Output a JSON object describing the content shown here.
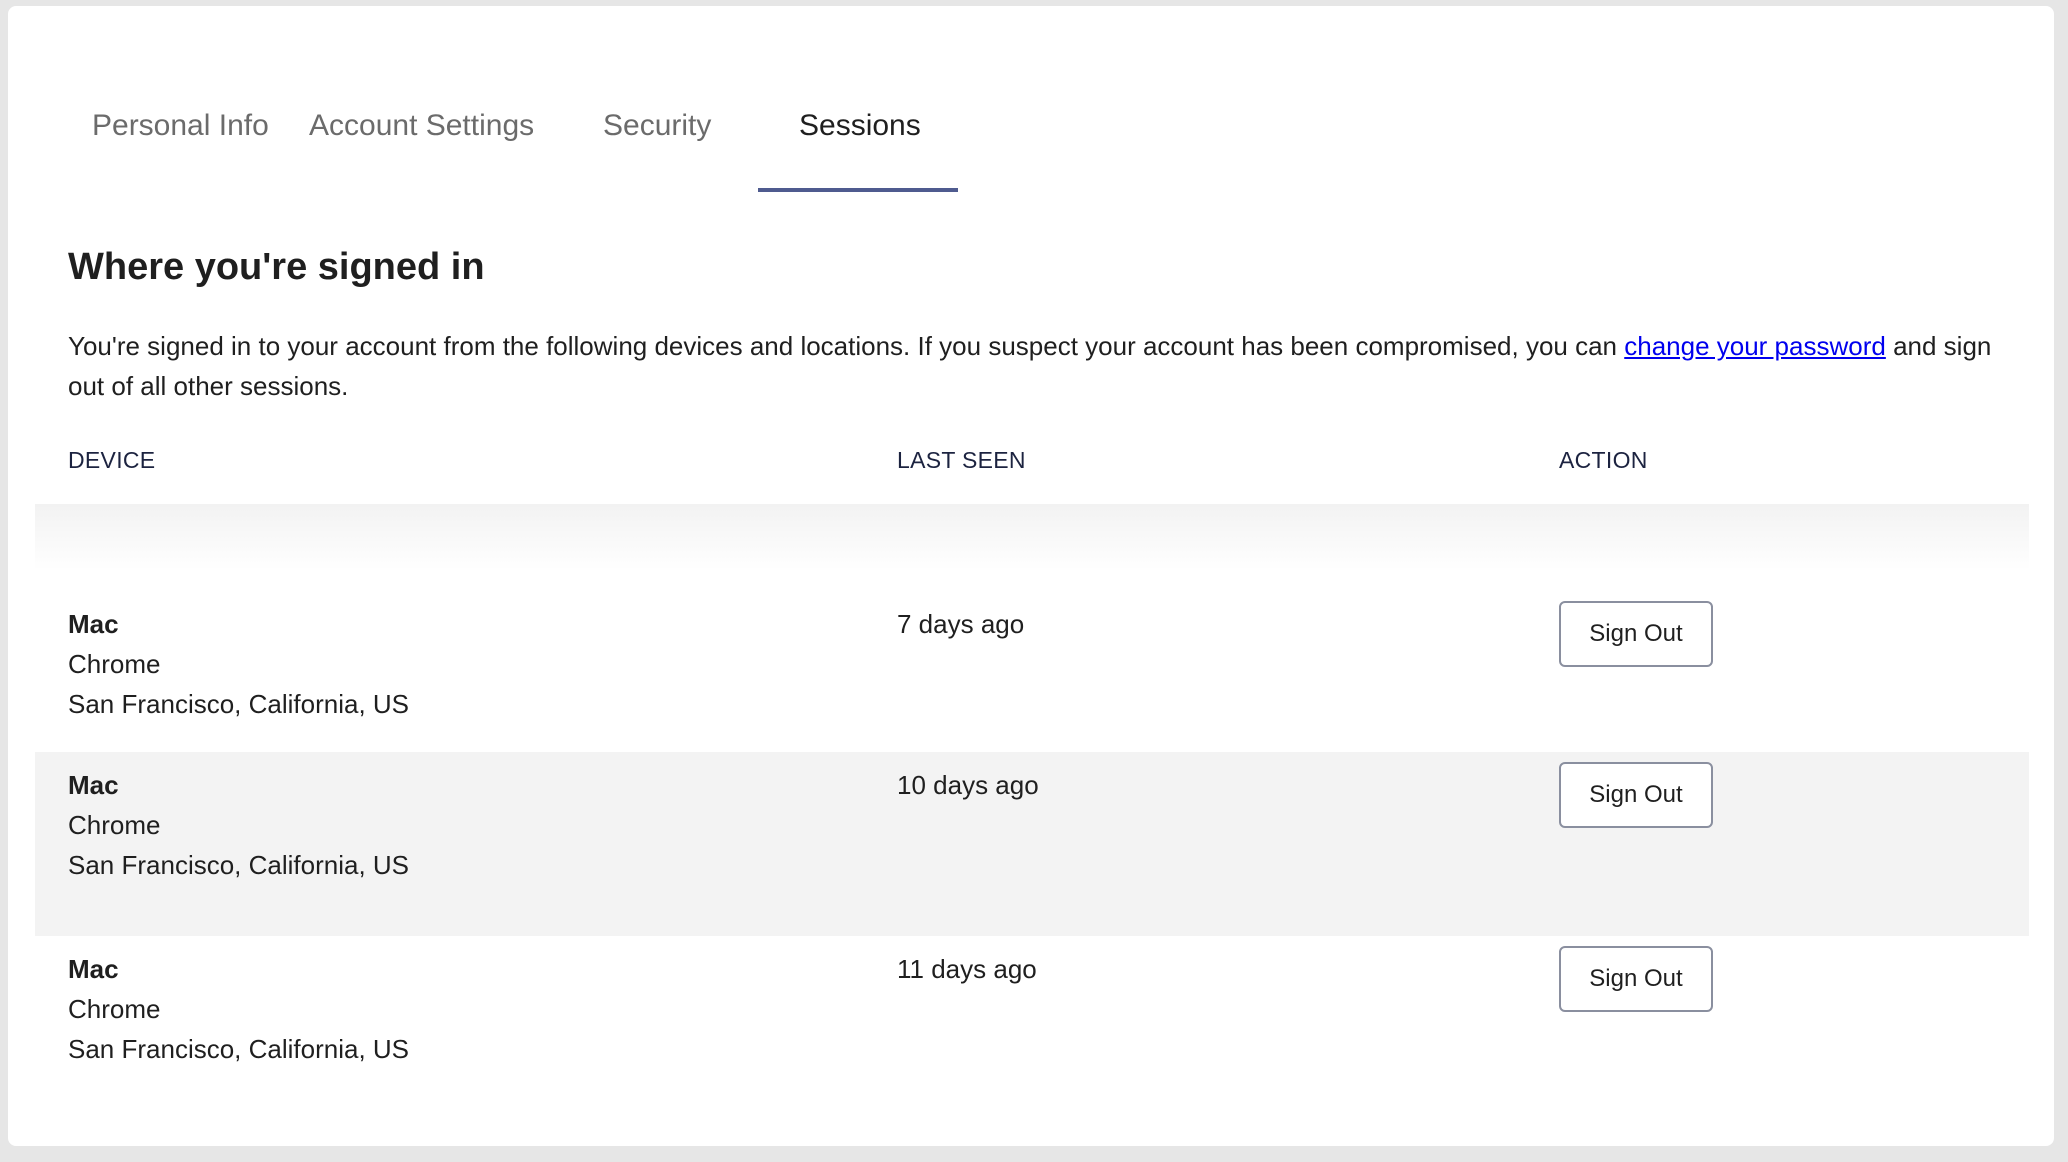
{
  "tabs": [
    {
      "label": "Personal Info",
      "active": false
    },
    {
      "label": "Account Settings",
      "active": false
    },
    {
      "label": "Security",
      "active": false
    },
    {
      "label": "Sessions",
      "active": true
    }
  ],
  "section": {
    "title": "Where you're signed in",
    "intro_before": "You're signed in to your account from the following devices and locations. If you suspect your account has been compromised, you can ",
    "intro_link": "change your password",
    "intro_after": " and sign out of all other sessions."
  },
  "table": {
    "headers": {
      "device": "DEVICE",
      "last_seen": "LAST SEEN",
      "action": "ACTION"
    },
    "rows": [
      {
        "device": "Mac",
        "browser": "Chrome",
        "location": "San Francisco, California, US",
        "last_seen": "7 days ago",
        "action_label": "Sign Out"
      },
      {
        "device": "Mac",
        "browser": "Chrome",
        "location": "San Francisco, California, US",
        "last_seen": "10 days ago",
        "action_label": "Sign Out"
      },
      {
        "device": "Mac",
        "browser": "Chrome",
        "location": "San Francisco, California, US",
        "last_seen": "11 days ago",
        "action_label": "Sign Out"
      }
    ]
  },
  "colors": {
    "accent_underline": "#4f5b8f",
    "link": "#0000ee",
    "alt_row": "#f3f3f3",
    "page_background": "#e6e6e6"
  }
}
